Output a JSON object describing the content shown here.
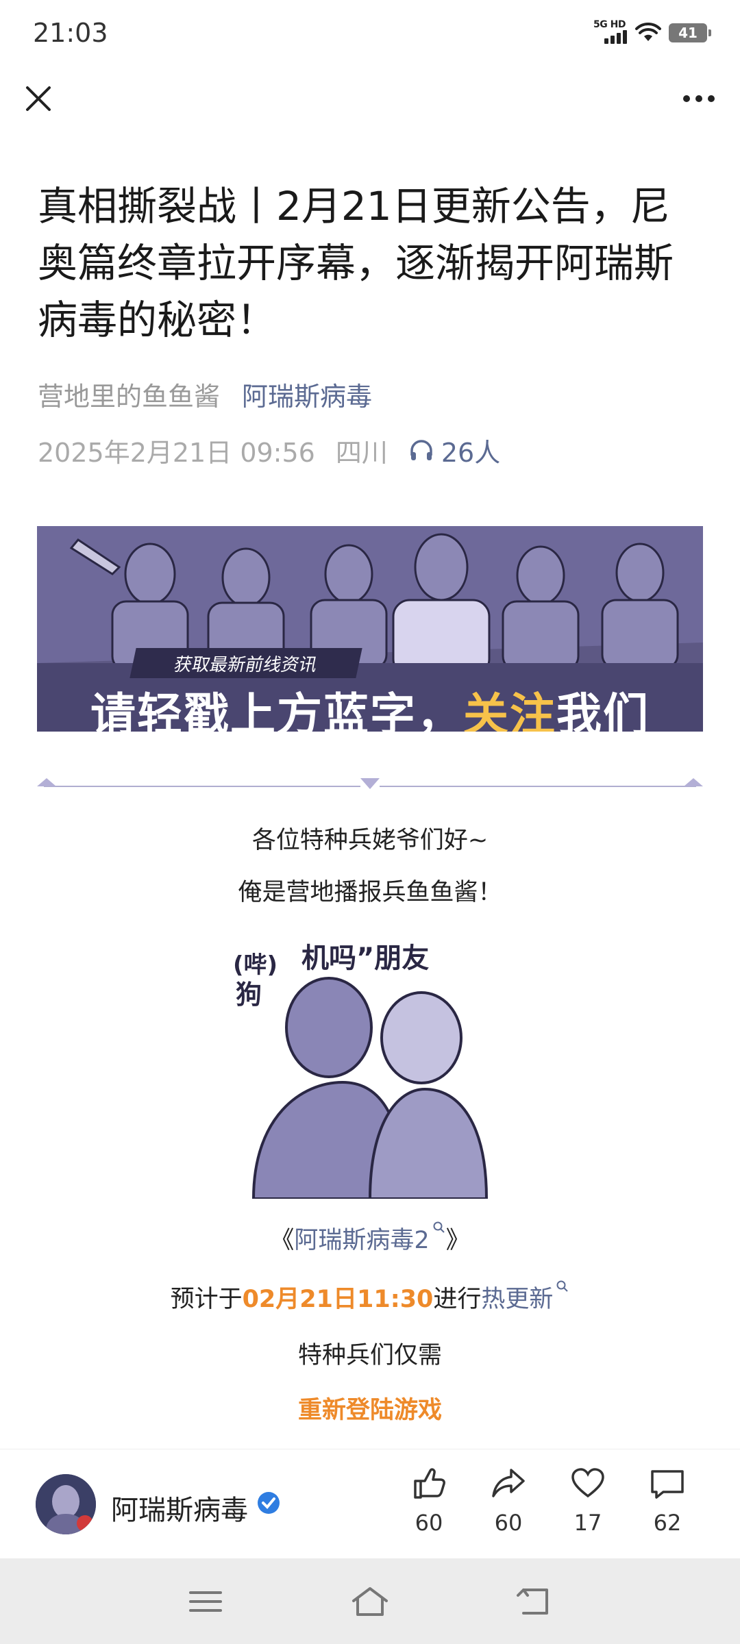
{
  "status_bar": {
    "time": "21:03",
    "network": "5G HD",
    "battery": "41"
  },
  "article": {
    "title": "真相撕裂战丨2月21日更新公告，尼奥篇终章拉开序幕，逐渐揭开阿瑞斯病毒的秘密！",
    "author": "营地里的鱼鱼酱",
    "account": "阿瑞斯病毒",
    "date": "2025年2月21日 09:56",
    "location": "四川",
    "listeners": "26人"
  },
  "banner": {
    "sub_text": "获取最新前线资讯",
    "big_text_a": "请轻戳上方蓝字，",
    "big_text_highlight": "关注",
    "big_text_b": "我们"
  },
  "body": {
    "greeting": "各位特种兵姥爷们好~",
    "intro": "俺是营地播报兵鱼鱼酱！",
    "game_open": "《",
    "game_name": "阿瑞斯病毒2",
    "game_close": "》",
    "update_prefix": "预计于",
    "update_time": "02月21日11:30",
    "update_mid": "进行",
    "update_link": "热更新",
    "only_need": "特种兵们仅需",
    "relogin": "重新登陆游戏"
  },
  "sticker_text": {
    "left": "(哔)",
    "left2": "狗",
    "right": "机吗”朋友"
  },
  "bottom_bar": {
    "account_name": "阿瑞斯病毒",
    "likes": "60",
    "shares": "60",
    "favorites": "17",
    "comments": "62"
  }
}
